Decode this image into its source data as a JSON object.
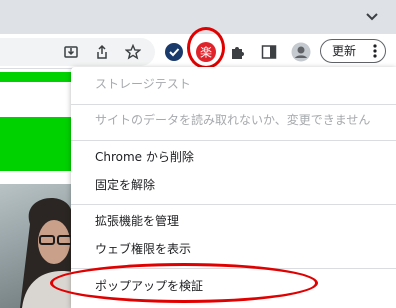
{
  "toolbar": {
    "update_label": "更新",
    "icons": [
      "install-icon",
      "share-icon",
      "bookmark-star-icon",
      "shield-extension-icon",
      "rakuten-extension-icon",
      "puzzle-extensions-icon",
      "side-panel-icon",
      "profile-avatar-icon",
      "more-menu-icon"
    ]
  },
  "context_menu": {
    "header": "ストレージテスト",
    "site_access": "サイトのデータを読み取れないか、変更できません",
    "remove": "Chrome から削除",
    "unpin": "固定を解除",
    "manage": "拡張機能を管理",
    "view_permissions": "ウェブ権限を表示",
    "inspect_popup": "ポップアップを検証"
  },
  "extension_badge": {
    "text": "楽"
  },
  "colors": {
    "accent_red": "#e00000",
    "green_block": "#00d200",
    "disabled_text": "#a6a9ad",
    "tabstrip": "#dee1e6"
  }
}
